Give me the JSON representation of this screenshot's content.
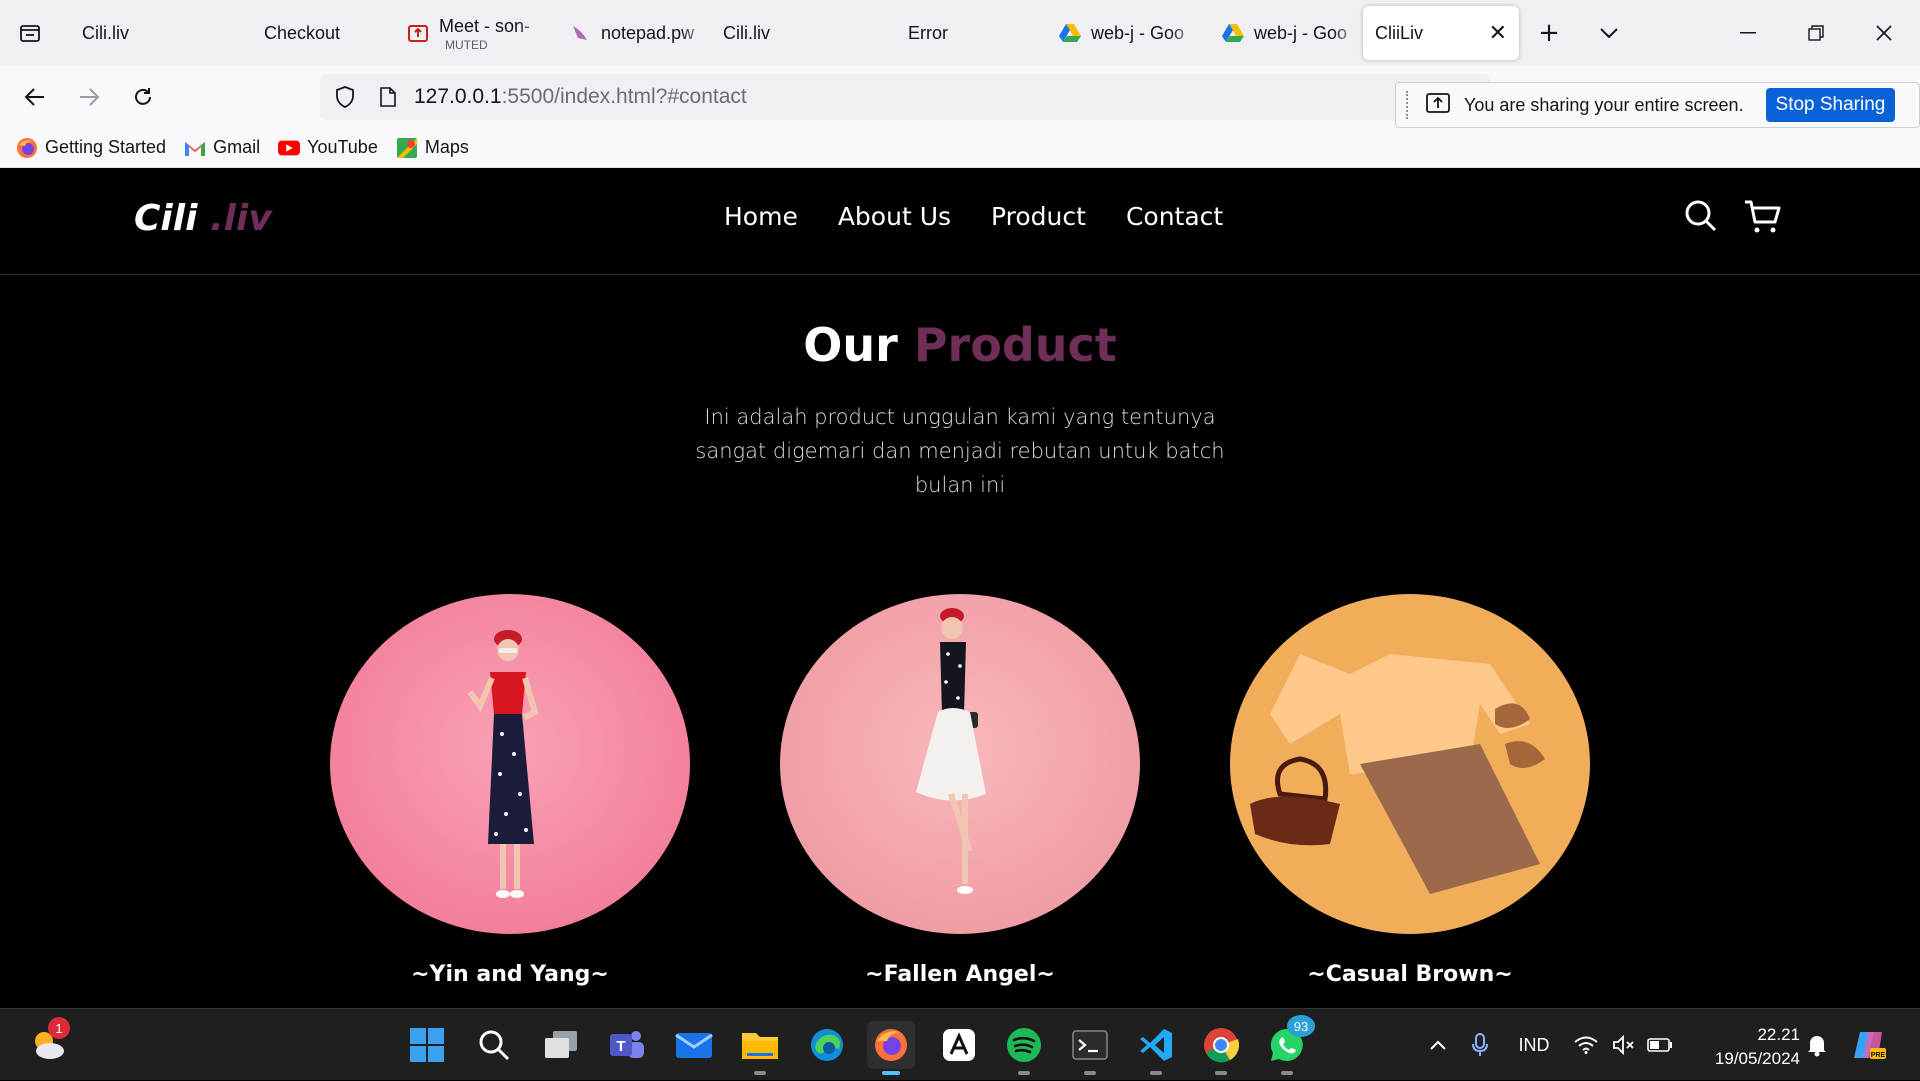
{
  "browser": {
    "tabs": [
      {
        "title": "Cili.liv",
        "icon": "page-icon"
      },
      {
        "title": "Checkout",
        "icon": "page-icon"
      },
      {
        "title": "Meet - son-",
        "subtitle": "MUTED",
        "icon": "meet-icon"
      },
      {
        "title": "notepad.pw",
        "icon": "notepad-icon"
      },
      {
        "title": "Cili.liv",
        "icon": "page-icon"
      },
      {
        "title": "Error",
        "icon": "page-icon"
      },
      {
        "title": "web-j - Goo",
        "icon": "drive-icon"
      },
      {
        "title": "web-j - Goo",
        "icon": "drive-icon"
      }
    ],
    "active_tab": {
      "title": "CliiLiv",
      "close": "✕"
    },
    "new_tab": "+",
    "url_host": "127.0.0.1",
    "url_rest": ":5500/index.html?#contact",
    "share_message": "You are sharing your entire screen.",
    "stop_sharing": "Stop Sharing",
    "bookmarks": [
      {
        "label": "Getting Started",
        "icon": "firefox-icon"
      },
      {
        "label": "Gmail",
        "icon": "gmail-icon"
      },
      {
        "label": "YouTube",
        "icon": "youtube-icon"
      },
      {
        "label": "Maps",
        "icon": "maps-icon"
      }
    ]
  },
  "site": {
    "logo_main": "Cili",
    "logo_accent": " .liv",
    "nav": [
      "Home",
      "About Us",
      "Product",
      "Contact"
    ],
    "section_title_main": "Our ",
    "section_title_accent": "Product",
    "section_desc": "Ini adalah product unggulan kami yang tentunya sangat digemari dan menjadi rebutan untuk batch bulan ini",
    "products": [
      {
        "name": "~Yin and Yang~"
      },
      {
        "name": "~Fallen Angel~"
      },
      {
        "name": "~Casual Brown~"
      }
    ],
    "colors": {
      "accent": "#6e2e58",
      "background": "#000000"
    }
  },
  "taskbar": {
    "weather_badge": "1",
    "whatsapp_badge": "93",
    "language": "IND",
    "time": "22.21",
    "date": "19/05/2024"
  }
}
